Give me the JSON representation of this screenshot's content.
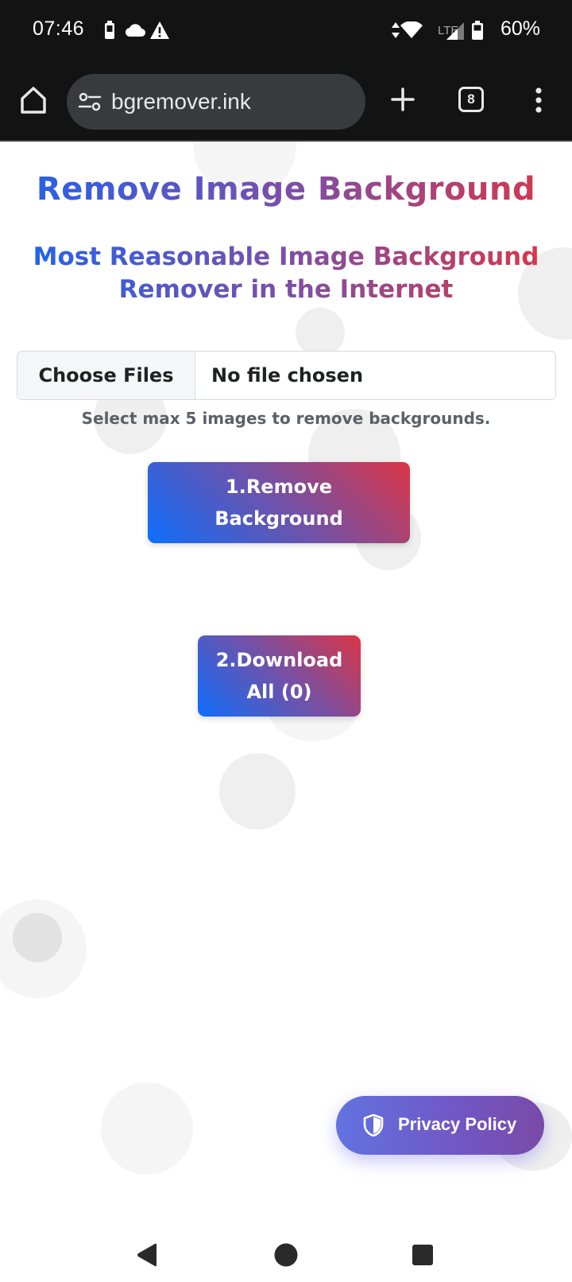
{
  "status_bar": {
    "time": "07:46",
    "battery_percent": "60%",
    "network_label": "LTE"
  },
  "browser": {
    "url": "bgremover.ink",
    "tab_count": "8"
  },
  "page": {
    "title": "Remove Image Background",
    "subtitle": "Most Reasonable Image Background Remover in the Internet",
    "file_input": {
      "button_label": "Choose Files",
      "status_text": "No file chosen"
    },
    "helper_text": "Select max 5 images to remove backgrounds.",
    "remove_button_label": "1.Remove Background",
    "download_button_label": "2.Download All (0)",
    "privacy_button_label": "Privacy Policy"
  },
  "colors": {
    "gradient_start": "#1e63f0",
    "gradient_mid": "#7b4fa8",
    "gradient_end": "#dc3545",
    "privacy_start": "#6173e0",
    "privacy_end": "#7a4aa6"
  },
  "icons": {
    "status": [
      "battery-saver-icon",
      "cloud-icon",
      "warning-icon",
      "data-arrows-icon",
      "wifi-icon",
      "signal-icon",
      "battery-icon"
    ],
    "toolbar": [
      "home-icon",
      "site-settings-icon",
      "new-tab-icon",
      "tab-switcher-icon",
      "more-menu-icon"
    ],
    "nav": [
      "back-icon",
      "home-circle-icon",
      "recents-icon"
    ],
    "privacy": "shield-icon"
  }
}
